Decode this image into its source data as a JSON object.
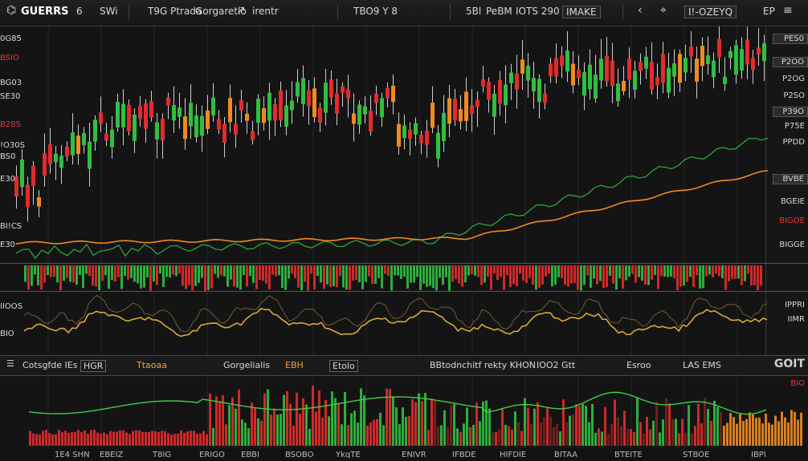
{
  "topbar": {
    "symbol": "GUERRS",
    "interval": "6",
    "chart_type": "SWi",
    "indicator_1": "T9G Ptrada",
    "indicator_2": "Gorgaretlo",
    "indicator_3": "irentr",
    "center_1": "TBO9 Y 8",
    "center_2": "5Bl",
    "center_3": "PeBM",
    "center_4": "IOTS 290",
    "center_5": "IMAKE",
    "right_label": "I!-OZEYQ",
    "right_small": "EP",
    "icons": [
      "chevron-left-icon",
      "crosshair-icon",
      "arrow-icon",
      "menu-icon"
    ]
  },
  "left_axis": [
    "0G85",
    "BSIO",
    "BG03",
    "SE30",
    "B28S",
    "!O30S",
    "BS0",
    "E30",
    "BI!CS",
    "E30"
  ],
  "right_axis": [
    "PES0",
    "P2OO",
    "P2OG",
    "P2SO",
    "P39O",
    "P75E",
    "PPDD",
    "BVBE",
    "BGEIE",
    "BIGOE",
    "BIGGE"
  ],
  "osc_labels": {
    "left_1": "IIOOS",
    "left_2": "BIO",
    "right_1": "IPPRI",
    "right_2": "IIMR"
  },
  "bottom_toolbar": {
    "item_1": "Cotsgfde IEs",
    "item_2": "HGR",
    "item_3": "Ttaoaa",
    "item_4": "Gorgelialis",
    "item_5": "EBH",
    "item_6": "Etolo",
    "item_7": "BBtodnchitf rekty KHON",
    "item_8": "IOO2 Gtt",
    "item_9": "Esroo",
    "item_10": "LAS EMS",
    "item_11": "GOIT",
    "item_12": "BIO"
  },
  "x_axis": [
    "1E4 SHN",
    "EBEIZ",
    "T8IG",
    "ERIGO",
    "EBBI",
    "BSOBO",
    "YkqTE",
    "ENIVR",
    "IFBDE",
    "HIFDIE",
    "BITAA",
    "BTEITE",
    "STBOE",
    "IBPI"
  ],
  "colors": {
    "up": "#2fbf40",
    "down": "#e32b2b",
    "orange": "#f08a1f",
    "green_line": "#2ea43a",
    "gold_line": "#d8a83a"
  }
}
